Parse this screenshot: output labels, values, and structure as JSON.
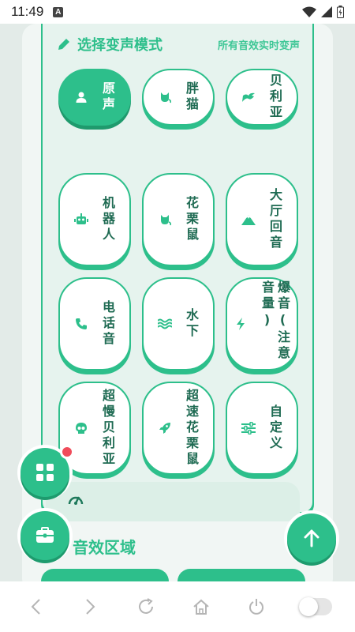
{
  "status": {
    "time": "11:49",
    "a_badge": "A"
  },
  "modes": {
    "title": "选择变声模式",
    "subtitle": "所有音效实时变声",
    "items": [
      {
        "label": "原声",
        "icon": "person-icon",
        "active": true
      },
      {
        "label": "胖猫",
        "icon": "cat-icon"
      },
      {
        "label": "贝利亚",
        "icon": "dragon-icon"
      },
      {
        "label": "机器人",
        "icon": "robot-icon"
      },
      {
        "label": "花栗鼠",
        "icon": "cat-icon"
      },
      {
        "label": "大厅回音",
        "icon": "mountain-icon"
      },
      {
        "label": "电话音",
        "icon": "phone-icon"
      },
      {
        "label": "水下",
        "icon": "water-icon"
      },
      {
        "label": "爆音(注意音量)",
        "icon": "bolt-icon"
      },
      {
        "label": "超慢贝利亚",
        "icon": "skull-icon"
      },
      {
        "label": "超速花栗鼠",
        "icon": "rocket-icon"
      },
      {
        "label": "自定义",
        "icon": "sliders-icon"
      }
    ]
  },
  "effects": {
    "title": "音效区域"
  },
  "colors": {
    "accent": "#2dbf8b",
    "badge": "#f04c5a"
  }
}
